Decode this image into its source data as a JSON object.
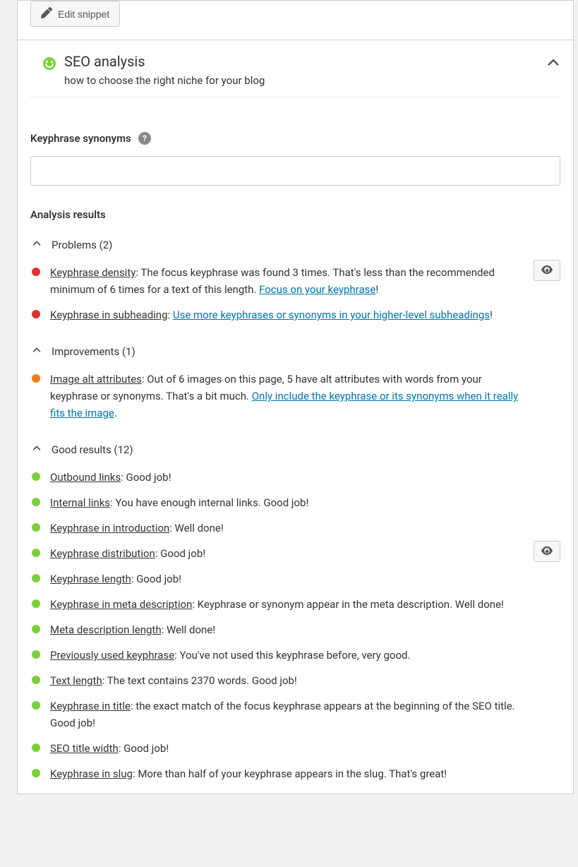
{
  "editButton": {
    "label": "Edit snippet"
  },
  "header": {
    "title": "SEO analysis",
    "subtitle": "how to choose the right niche for your blog"
  },
  "synonyms": {
    "label": "Keyphrase synonyms",
    "value": ""
  },
  "analysisTitle": "Analysis results",
  "sections": {
    "problems": {
      "label": "Problems (2)"
    },
    "improvements": {
      "label": "Improvements (1)"
    },
    "good": {
      "label": "Good results (12)"
    }
  },
  "problems": [
    {
      "link1": "Keyphrase density",
      "text1": ": The focus keyphrase was found 3 times. That's less than the recommended minimum of 6 times for a text of this length. ",
      "link2": "Focus on your keyphrase",
      "text2": "!",
      "hasEye": true
    },
    {
      "link1": "Keyphrase in subheading",
      "text1": ": ",
      "link2": "Use more keyphrases or synonyms in your higher-level subheadings",
      "text2": "!",
      "hasEye": false
    }
  ],
  "improvements": [
    {
      "link1": "Image alt attributes",
      "text1": ": Out of 6 images on this page, 5 have alt attributes with words from your keyphrase or synonyms. That's a bit much. ",
      "link2": "Only include the keyphrase or its synonyms when it really fits the image",
      "text2": ".",
      "hasEye": false
    }
  ],
  "good": [
    {
      "link1": "Outbound links",
      "text1": ": Good job!",
      "hasEye": false
    },
    {
      "link1": "Internal links",
      "text1": ": You have enough internal links. Good job!",
      "hasEye": false
    },
    {
      "link1": "Keyphrase in introduction",
      "text1": ": Well done!",
      "hasEye": false
    },
    {
      "link1": "Keyphrase distribution",
      "text1": ": Good job!",
      "hasEye": true
    },
    {
      "link1": "Keyphrase length",
      "text1": ": Good job!",
      "hasEye": false
    },
    {
      "link1": "Keyphrase in meta description",
      "text1": ": Keyphrase or synonym appear in the meta description. Well done!",
      "hasEye": false
    },
    {
      "link1": "Meta description length",
      "text1": ": Well done!",
      "hasEye": false
    },
    {
      "link1": "Previously used keyphrase",
      "text1": ": You've not used this keyphrase before, very good.",
      "hasEye": false
    },
    {
      "link1": "Text length",
      "text1": ": The text contains 2370 words. Good job!",
      "hasEye": false
    },
    {
      "link1": "Keyphrase in title",
      "text1": ": the exact match of the focus keyphrase appears at the beginning of the SEO title. Good job!",
      "hasEye": false
    },
    {
      "link1": "SEO title width",
      "text1": ": Good job!",
      "hasEye": false
    },
    {
      "link1": "Keyphrase in slug",
      "text1": ": More than half of your keyphrase appears in the slug. That's great!",
      "hasEye": false
    }
  ]
}
